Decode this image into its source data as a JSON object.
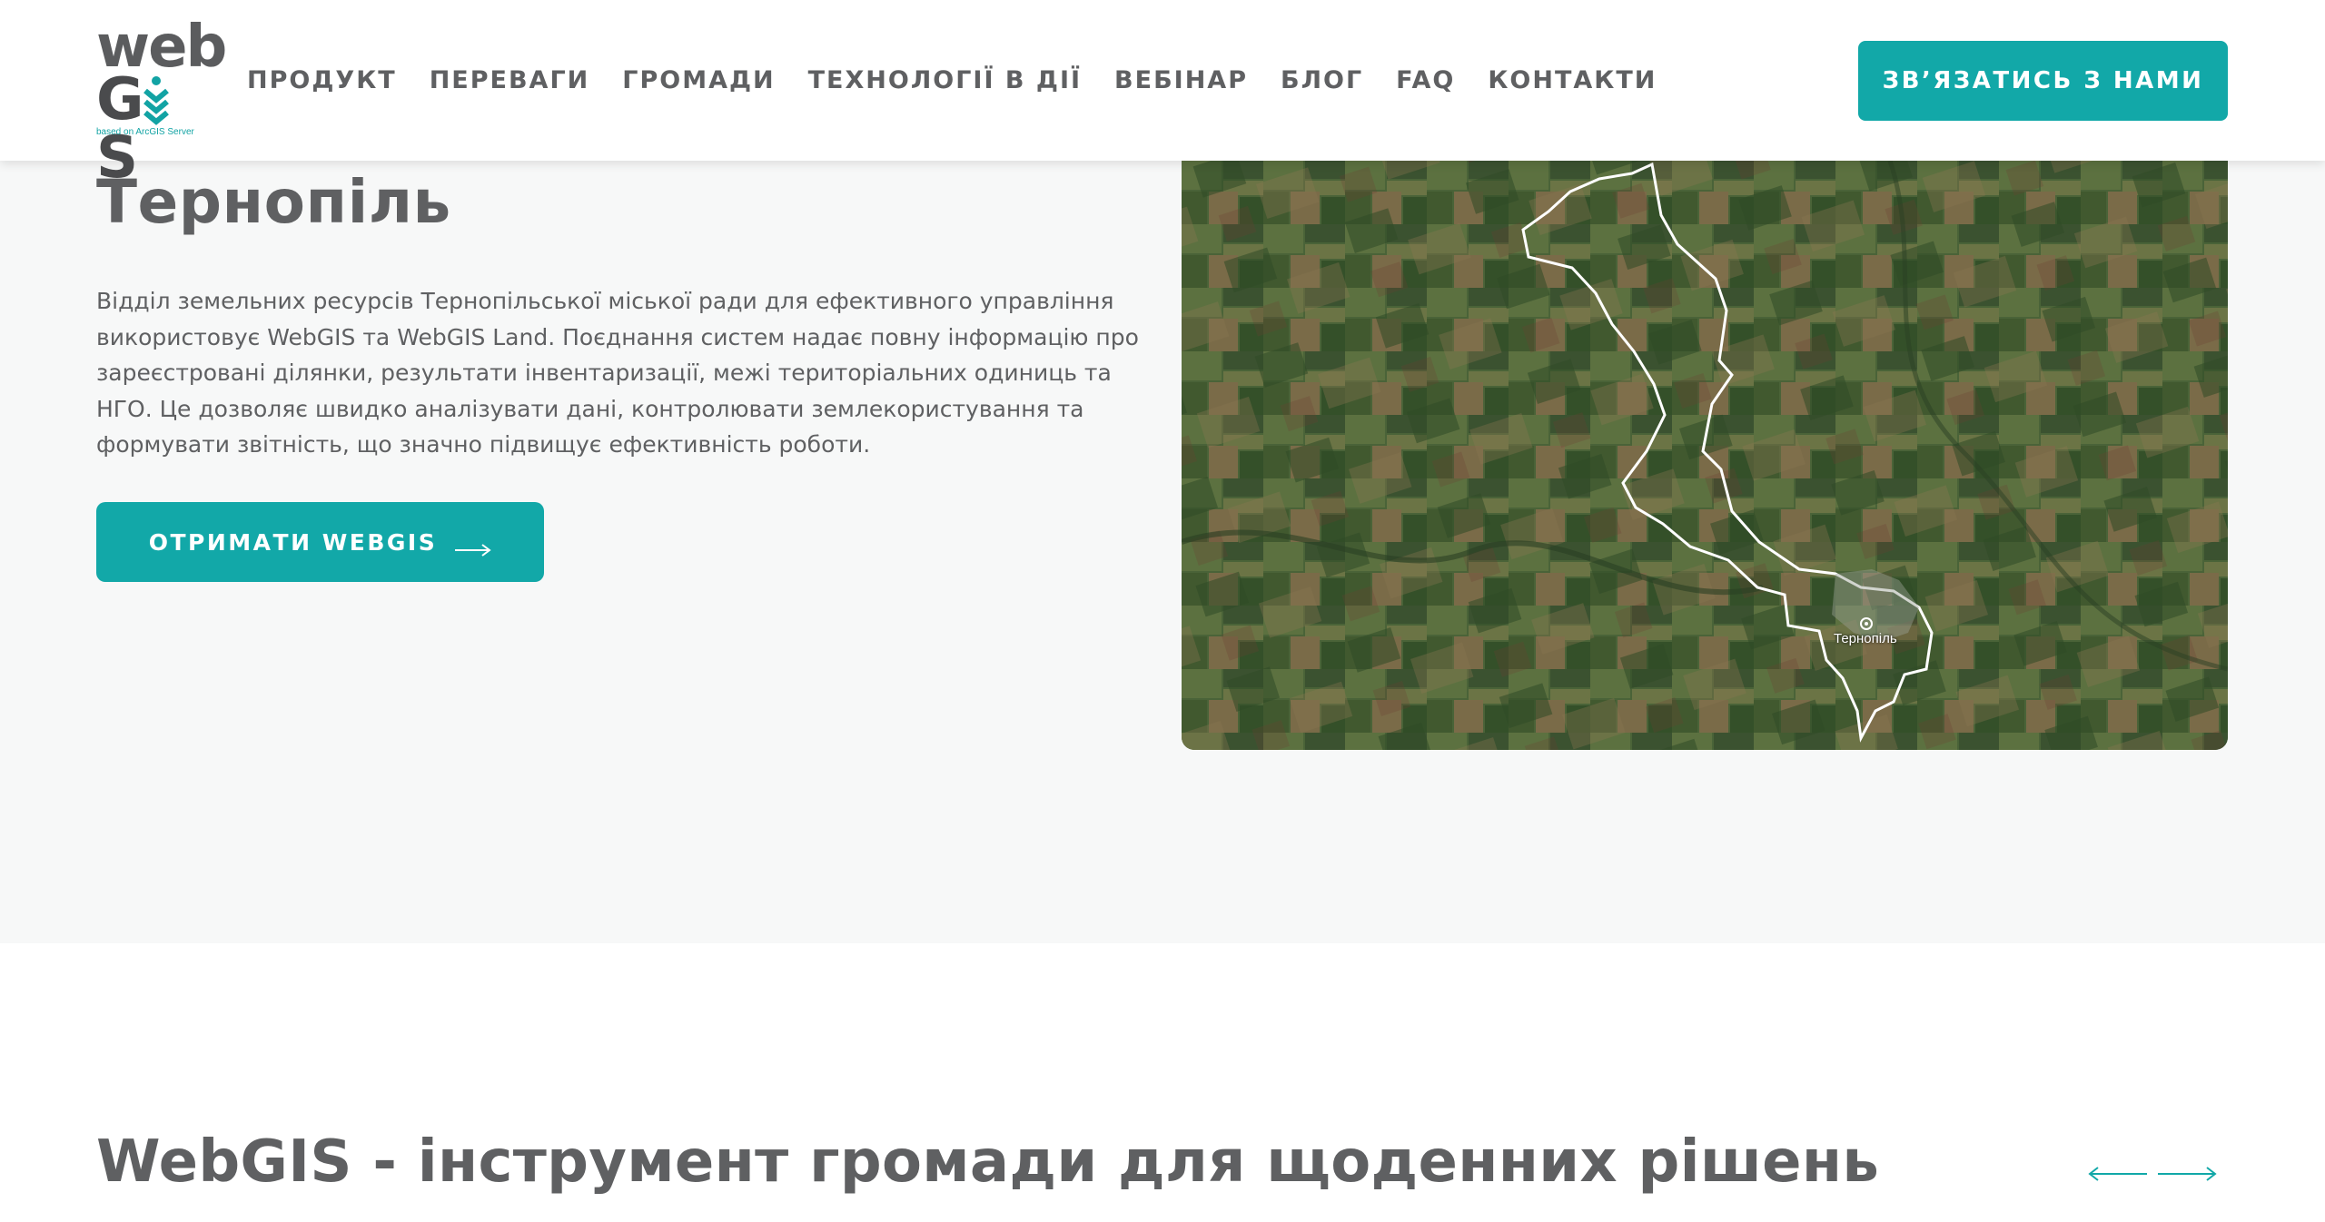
{
  "header": {
    "logo": {
      "word_top": "web",
      "word_bottom_g": "G",
      "word_bottom_s": "S",
      "tagline": "based on ArcGIS Server"
    },
    "nav": [
      {
        "label": "ПРОДУКТ"
      },
      {
        "label": "ПЕРЕВАГИ"
      },
      {
        "label": "ГРОМАДИ"
      },
      {
        "label": "ТЕХНОЛОГІЇ В ДІЇ"
      },
      {
        "label": "ВЕБІНАР"
      },
      {
        "label": "БЛОГ"
      },
      {
        "label": "FAQ"
      },
      {
        "label": "КОНТАКТИ"
      }
    ],
    "contact_button": "ЗВʼЯЗАТИСЬ З НАМИ"
  },
  "hero": {
    "title": "Тернопіль",
    "description": "Відділ земельних ресурсів Тернопільської міської ради для ефективного управління використовує WebGIS та WebGIS Land. Поєднання систем надає повну інформацію про зареєстровані ділянки, результати інвентаризації, межі територіальних одиниць та НГО. Це дозволяє швидко аналізувати дані, контролювати землекористування та формувати звітність, що значно підвищує ефективність роботи.",
    "cta_label": "ОТРИМАТИ WEBGIS",
    "map_label": "Тернопіль"
  },
  "section": {
    "title": "WebGIS - інструмент громади для щоденних рішень"
  },
  "colors": {
    "accent": "#12a8a8",
    "text": "#5f6062",
    "hero_bg": "#f7f8f8"
  },
  "icons": {
    "cta_arrow": "arrow-right-icon",
    "slider_prev": "arrow-left-icon",
    "slider_next": "arrow-right-icon"
  }
}
